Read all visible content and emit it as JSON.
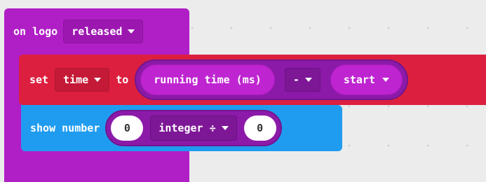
{
  "event_block": {
    "label": "on logo",
    "dropdown_value": "released"
  },
  "set_block": {
    "label_set": "set",
    "variable": "time",
    "label_to": "to",
    "minus_op": {
      "left_reporter": "running time (ms)",
      "operator": "-",
      "right_variable": "start"
    }
  },
  "show_block": {
    "label": "show number",
    "divide_op": {
      "left_value": "0",
      "operator": "integer ÷",
      "right_value": "0"
    }
  },
  "colors": {
    "event": "#b01ec5",
    "variables": "#dc1f3f",
    "math": "#8c1aa9",
    "basic": "#1f9cf0",
    "workspace": "#ececec"
  }
}
